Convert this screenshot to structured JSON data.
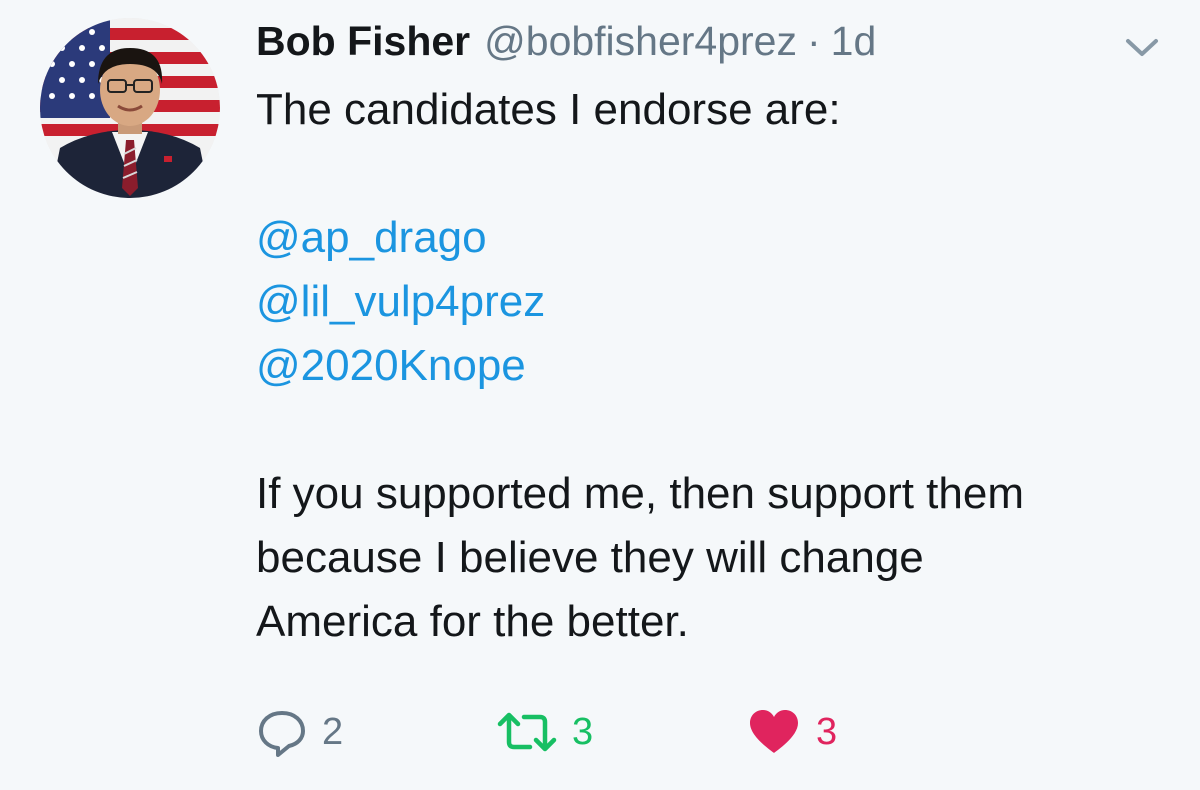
{
  "author": {
    "name": "Bob Fisher",
    "handle": "@bobfisher4prez",
    "separator": "·",
    "time": "1d"
  },
  "tweet": {
    "intro": "The candidates I endorse are:",
    "mentions": [
      "@ap_drago",
      "@lil_vulp4prez",
      "@2020Knope"
    ],
    "outro_lines": [
      "If you supported me, then support them",
      "because I believe they will change",
      "America for the better."
    ]
  },
  "actions": {
    "reply_count": "2",
    "retweet_count": "3",
    "like_count": "3"
  },
  "icons": {
    "reply": "reply-icon",
    "retweet": "retweet-icon",
    "like": "heart-icon",
    "menu": "chevron-down-icon"
  },
  "colors": {
    "background": "#f5f8fa",
    "mention": "#1b95e0",
    "secondary": "#657786",
    "retweet": "#17bf63",
    "like": "#e0245e"
  }
}
